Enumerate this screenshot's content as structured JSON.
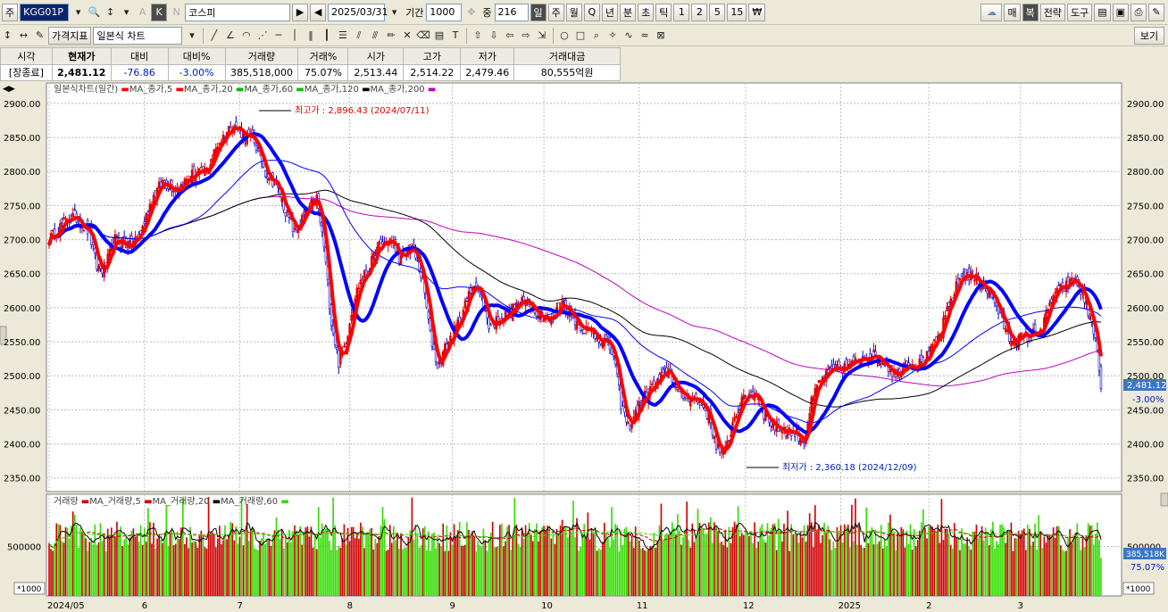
{
  "toolbar1": {
    "type_label": "주",
    "code": "KGG01P",
    "k_label": "K",
    "n_label": "N",
    "market_name": "코스피",
    "date": "2025/03/31",
    "period_label": "기간",
    "period_value": "1000",
    "mid_label": "중",
    "mid_value": "216",
    "periods": [
      "일",
      "주",
      "월",
      "Q",
      "년",
      "분",
      "초",
      "틱",
      "1",
      "2",
      "5",
      "15"
    ],
    "right_buttons": [
      "매",
      "복",
      "전략",
      "도구"
    ]
  },
  "toolbar2": {
    "price_index_label": "가격지표",
    "chart_type": "일본식 차트",
    "view_label": "보기"
  },
  "quote": {
    "headers": [
      "시각",
      "현재가",
      "대비",
      "대비%",
      "거래량",
      "거래%",
      "시가",
      "고가",
      "저가",
      "거래대금"
    ],
    "values": [
      "[장종료]",
      "2,481.12",
      "-76.86",
      "-3.00%",
      "385,518,000",
      "75.07%",
      "2,513.44",
      "2,514.22",
      "2,479.46",
      "80,555억원"
    ]
  },
  "price_legend": [
    "일본식차트(일간)",
    "MA_종가,5",
    "MA_종가,20",
    "MA_종가,60",
    "MA_종가,120",
    "MA_종가,200"
  ],
  "volume_legend": [
    "거래량",
    "MA_거래량,5",
    "MA_거래량,20",
    "MA_거래량,60"
  ],
  "annotations": {
    "high": "최고가 : 2,896.43 (2024/07/11)",
    "low": "최저가 : 2,360.18 (2024/12/09)"
  },
  "current_badges": {
    "price": "2,481.12",
    "pct": "-3.00%",
    "volume": "385,518K",
    "vol_pct": "75.07%"
  },
  "units": {
    "left": "*1000",
    "right": "*1000"
  },
  "colors": {
    "up": "#e00000",
    "down": "#0000d0",
    "ma5": "#ff0000",
    "ma20": "#00c000",
    "ma60": "#0000ff",
    "ma120": "#000000",
    "ma200": "#c000c0",
    "vol_up": "#d00000",
    "vol_down": "#33dd00"
  },
  "chart_data": [
    {
      "type": "candlestick",
      "title": "일본식차트(일간)",
      "x_ticks": [
        "2024/05",
        "6",
        "7",
        "8",
        "9",
        "10",
        "11",
        "12",
        "2025",
        "2",
        "3"
      ],
      "y_ticks": [
        2350,
        2400,
        2450,
        2500,
        2550,
        2600,
        2650,
        2700,
        2750,
        2800,
        2850,
        2900
      ],
      "ylim": [
        2330,
        2930
      ],
      "grid": true,
      "price_path": [
        [
          0,
          2700
        ],
        [
          8,
          2725
        ],
        [
          14,
          2735
        ],
        [
          22,
          2710
        ],
        [
          26,
          2660
        ],
        [
          30,
          2655
        ],
        [
          36,
          2700
        ],
        [
          44,
          2690
        ],
        [
          50,
          2710
        ],
        [
          56,
          2760
        ],
        [
          62,
          2785
        ],
        [
          70,
          2775
        ],
        [
          78,
          2795
        ],
        [
          86,
          2800
        ],
        [
          92,
          2840
        ],
        [
          100,
          2870
        ],
        [
          106,
          2855
        ],
        [
          112,
          2845
        ],
        [
          118,
          2800
        ],
        [
          124,
          2780
        ],
        [
          128,
          2750
        ],
        [
          134,
          2710
        ],
        [
          140,
          2740
        ],
        [
          146,
          2760
        ],
        [
          150,
          2690
        ],
        [
          154,
          2580
        ],
        [
          158,
          2520
        ],
        [
          162,
          2550
        ],
        [
          166,
          2610
        ],
        [
          170,
          2640
        ],
        [
          174,
          2655
        ],
        [
          180,
          2690
        ],
        [
          186,
          2700
        ],
        [
          192,
          2670
        ],
        [
          198,
          2690
        ],
        [
          204,
          2640
        ],
        [
          208,
          2560
        ],
        [
          212,
          2515
        ],
        [
          216,
          2540
        ],
        [
          222,
          2570
        ],
        [
          228,
          2610
        ],
        [
          232,
          2640
        ],
        [
          236,
          2615
        ],
        [
          240,
          2575
        ],
        [
          244,
          2580
        ],
        [
          250,
          2590
        ],
        [
          256,
          2605
        ],
        [
          262,
          2610
        ],
        [
          268,
          2590
        ],
        [
          274,
          2580
        ],
        [
          280,
          2610
        ],
        [
          286,
          2585
        ],
        [
          292,
          2570
        ],
        [
          298,
          2560
        ],
        [
          304,
          2550
        ],
        [
          308,
          2530
        ],
        [
          312,
          2460
        ],
        [
          316,
          2425
        ],
        [
          320,
          2445
        ],
        [
          326,
          2475
        ],
        [
          332,
          2490
        ],
        [
          338,
          2510
        ],
        [
          344,
          2470
        ],
        [
          350,
          2470
        ],
        [
          356,
          2460
        ],
        [
          360,
          2440
        ],
        [
          364,
          2400
        ],
        [
          368,
          2380
        ],
        [
          374,
          2440
        ],
        [
          380,
          2470
        ],
        [
          386,
          2475
        ],
        [
          390,
          2445
        ],
        [
          396,
          2425
        ],
        [
          402,
          2420
        ],
        [
          408,
          2415
        ],
        [
          412,
          2405
        ],
        [
          416,
          2460
        ],
        [
          420,
          2490
        ],
        [
          426,
          2505
        ],
        [
          432,
          2510
        ],
        [
          438,
          2515
        ],
        [
          444,
          2530
        ],
        [
          450,
          2530
        ],
        [
          456,
          2520
        ],
        [
          462,
          2500
        ],
        [
          468,
          2520
        ],
        [
          474,
          2515
        ],
        [
          480,
          2530
        ],
        [
          486,
          2560
        ],
        [
          492,
          2610
        ],
        [
          498,
          2650
        ],
        [
          504,
          2645
        ],
        [
          510,
          2635
        ],
        [
          516,
          2610
        ],
        [
          520,
          2580
        ],
        [
          524,
          2555
        ],
        [
          530,
          2555
        ],
        [
          536,
          2560
        ],
        [
          542,
          2570
        ],
        [
          548,
          2620
        ],
        [
          554,
          2630
        ],
        [
          560,
          2640
        ],
        [
          564,
          2620
        ],
        [
          568,
          2585
        ],
        [
          571,
          2560
        ],
        [
          573,
          2500
        ]
      ]
    },
    {
      "type": "bar",
      "title": "거래량",
      "y_ticks": [
        500000
      ],
      "grid": true
    }
  ]
}
